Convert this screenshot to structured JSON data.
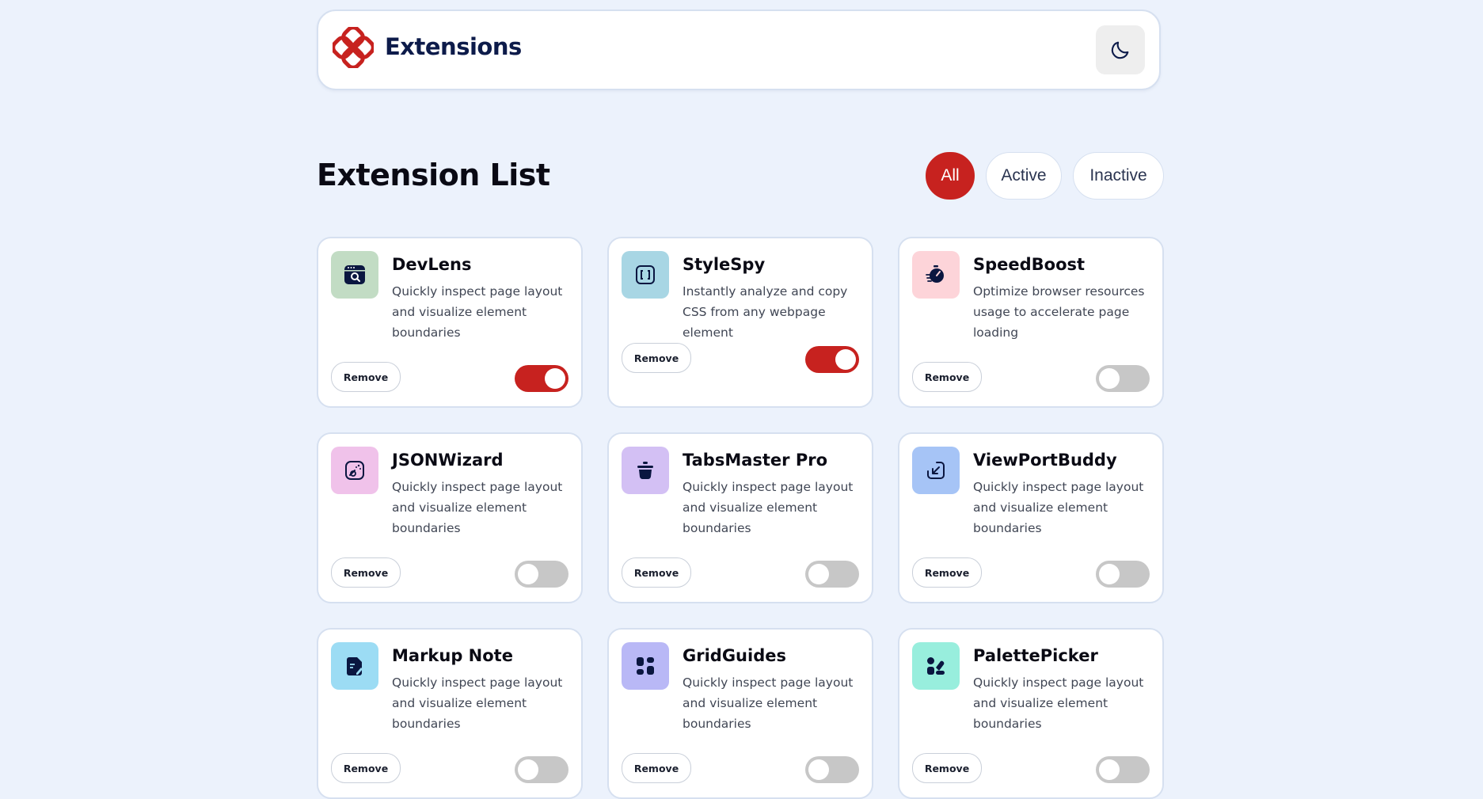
{
  "header": {
    "brand": "Extensions",
    "theme_icon": "moon-icon",
    "logo_icon": "extensions-logo-icon",
    "accent_color": "#c7221f"
  },
  "list": {
    "title": "Extension List",
    "filters": [
      {
        "label": "All",
        "selected": true
      },
      {
        "label": "Active",
        "selected": false
      },
      {
        "label": "Inactive",
        "selected": false
      }
    ]
  },
  "extensions": [
    {
      "name": "DevLens",
      "description": "Quickly inspect page layout and visualize element boundaries",
      "remove_label": "Remove",
      "active": true,
      "icon": "devlens-icon",
      "icon_bg": "#c2dcc4"
    },
    {
      "name": "StyleSpy",
      "description": "Instantly analyze and copy CSS from any webpage element",
      "remove_label": "Remove",
      "active": true,
      "icon": "stylespy-icon",
      "icon_bg": "#a8d6e4"
    },
    {
      "name": "SpeedBoost",
      "description": "Optimize browser resources usage to accelerate page loading",
      "remove_label": "Remove",
      "active": false,
      "icon": "speedboost-icon",
      "icon_bg": "#fdd4d9"
    },
    {
      "name": "JSONWizard",
      "description": "Quickly inspect page layout and visualize element boundaries",
      "remove_label": "Remove",
      "active": false,
      "icon": "jsonwizard-icon",
      "icon_bg": "#f0c2ea"
    },
    {
      "name": "TabsMaster Pro",
      "description": "Quickly inspect page layout and visualize element boundaries",
      "remove_label": "Remove",
      "active": false,
      "icon": "tabsmaster-icon",
      "icon_bg": "#d3c0f4"
    },
    {
      "name": "ViewPortBuddy",
      "description": "Quickly inspect page layout and visualize element boundaries",
      "remove_label": "Remove",
      "active": false,
      "icon": "viewportbuddy-icon",
      "icon_bg": "#a6c4f6"
    },
    {
      "name": "Markup Note",
      "description": "Quickly inspect page layout and visualize element boundaries",
      "remove_label": "Remove",
      "active": false,
      "icon": "markupnote-icon",
      "icon_bg": "#9cdcf4"
    },
    {
      "name": "GridGuides",
      "description": "Quickly inspect page layout and visualize element boundaries",
      "remove_label": "Remove",
      "active": false,
      "icon": "gridguides-icon",
      "icon_bg": "#b9b8f6"
    },
    {
      "name": "PalettePicker",
      "description": "Quickly inspect page layout and visualize element boundaries",
      "remove_label": "Remove",
      "active": false,
      "icon": "palettepicker-icon",
      "icon_bg": "#98eedd"
    }
  ]
}
